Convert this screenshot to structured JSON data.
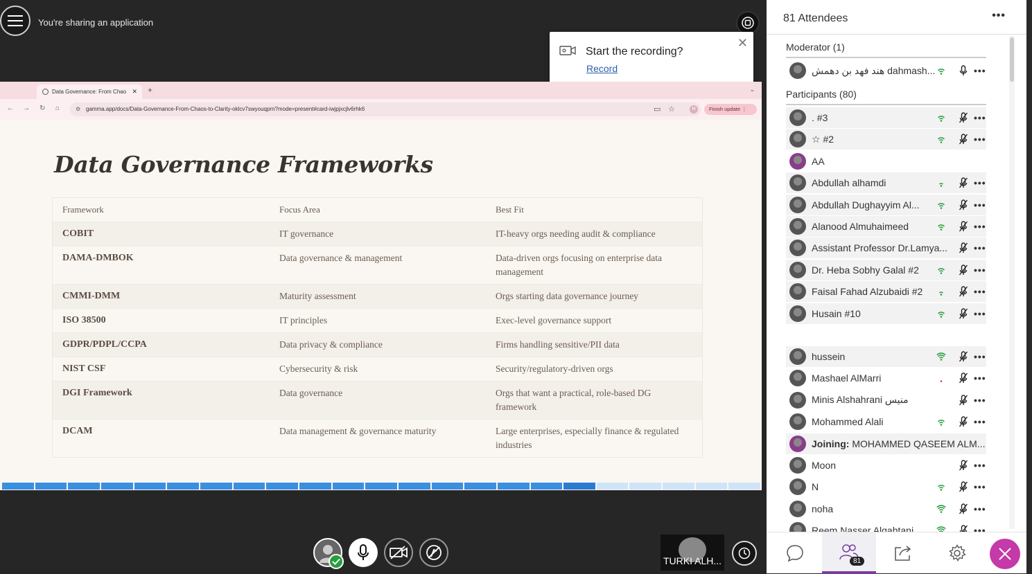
{
  "session": {
    "sharing_text": "You're sharing an application",
    "recording_prompt": "Start the recording?",
    "record_link": "Record"
  },
  "browser": {
    "tab_title": "Data Governance: From Chao",
    "url": "gamma.app/docs/Data-Governance-From-Chaos-to-Clarity-oklcv7swyouqprn?mode=present#card-iwjpjxcjlv6rhk6",
    "profile_initial": "H",
    "finish_update": "Finish update"
  },
  "slide": {
    "title": "Data Governance Frameworks",
    "headers": [
      "Framework",
      "Focus Area",
      "Best Fit"
    ],
    "rows": [
      [
        "COBIT",
        "IT governance",
        "IT-heavy orgs needing audit & compliance"
      ],
      [
        "DAMA-DMBOK",
        "Data governance & management",
        "Data-driven orgs focusing on enterprise data management"
      ],
      [
        "CMMI-DMM",
        "Maturity assessment",
        "Orgs starting data governance journey"
      ],
      [
        "ISO 38500",
        "IT principles",
        "Exec-level governance support"
      ],
      [
        "GDPR/PDPL/CCPA",
        "Data privacy & compliance",
        "Firms handling sensitive/PII data"
      ],
      [
        "NIST CSF",
        "Cybersecurity & risk",
        "Security/regulatory-driven orgs"
      ],
      [
        "DGI Framework",
        "Data governance",
        "Orgs that want a practical, role-based DG framework"
      ],
      [
        "DCAM",
        "Data management & governance maturity",
        "Large enterprises, especially finance & regulated industries"
      ]
    ],
    "progress": {
      "total": 23,
      "completed": 18
    }
  },
  "presenter": {
    "speaker_name": "TURKI ALH..."
  },
  "panel": {
    "title": "81 Attendees",
    "moderator_label": "Moderator (1)",
    "participants_label": "Participants (80)",
    "badge_count": "81",
    "moderators": [
      {
        "name": "هند فهد بن دهمش dahmash...",
        "shaded": false,
        "signal": "strong",
        "mic": "on",
        "more": true
      }
    ],
    "participants": [
      {
        "name": ". #3",
        "shaded": true,
        "signal": "strong",
        "mic": "muted",
        "more": true
      },
      {
        "name": "☆ #2",
        "shaded": true,
        "signal": "strong",
        "mic": "muted",
        "more": true
      },
      {
        "name": "AA",
        "shaded": false,
        "signal": "",
        "mic": "",
        "more": false,
        "pending": true
      },
      {
        "name": "Abdullah alhamdi",
        "shaded": true,
        "signal": "weak",
        "mic": "muted",
        "more": true
      },
      {
        "name": "Abdullah Dughayyim Al...",
        "shaded": true,
        "signal": "strong",
        "mic": "muted",
        "more": true
      },
      {
        "name": "Alanood Almuhaimeed",
        "shaded": true,
        "signal": "strong",
        "mic": "muted",
        "more": true
      },
      {
        "name": "Assistant Professor Dr.Lamya...",
        "shaded": true,
        "signal": "",
        "mic": "muted",
        "more": true
      },
      {
        "name": "Dr. Heba Sobhy Galal #2",
        "shaded": true,
        "signal": "strong",
        "mic": "muted",
        "more": true
      },
      {
        "name": "Faisal Fahad Alzubaidi #2",
        "shaded": true,
        "signal": "weak",
        "mic": "muted",
        "more": true
      },
      {
        "name": "Husain #10",
        "shaded": true,
        "signal": "strong",
        "mic": "muted",
        "more": true
      },
      {
        "name": "hussein",
        "shaded": true,
        "signal": "full",
        "mic": "muted",
        "more": true,
        "gap": true
      },
      {
        "name": "Mashael AlMarri",
        "shaded": false,
        "signal": "poor",
        "mic": "muted",
        "more": true
      },
      {
        "name": "Minis Alshahrani منيس",
        "shaded": false,
        "signal": "",
        "mic": "muted",
        "more": true
      },
      {
        "name": "Mohammed Alali",
        "shaded": false,
        "signal": "strong",
        "mic": "muted",
        "more": true
      },
      {
        "name_prefix": "Joining:",
        "name": "MOHAMMED QASEEM ALM...",
        "shaded": true,
        "signal": "",
        "mic": "",
        "more": false,
        "pending": true
      },
      {
        "name": "Moon",
        "shaded": false,
        "signal": "",
        "mic": "muted",
        "more": true
      },
      {
        "name": "N",
        "shaded": false,
        "signal": "strong",
        "mic": "muted",
        "more": true
      },
      {
        "name": "noha",
        "shaded": false,
        "signal": "full",
        "mic": "muted",
        "more": true
      },
      {
        "name": "Reem Nasser Alqahtani",
        "shaded": false,
        "signal": "full",
        "mic": "muted",
        "more": true
      }
    ]
  },
  "colors": {
    "accent": "#7b3ca1",
    "close_button": "#c43aa8",
    "signal_green": "#2a9d3f",
    "signal_red": "#d33",
    "progress_done": "#3b8fe0",
    "progress_current": "#2c7ad3",
    "progress_remaining": "#cfe4f8"
  }
}
